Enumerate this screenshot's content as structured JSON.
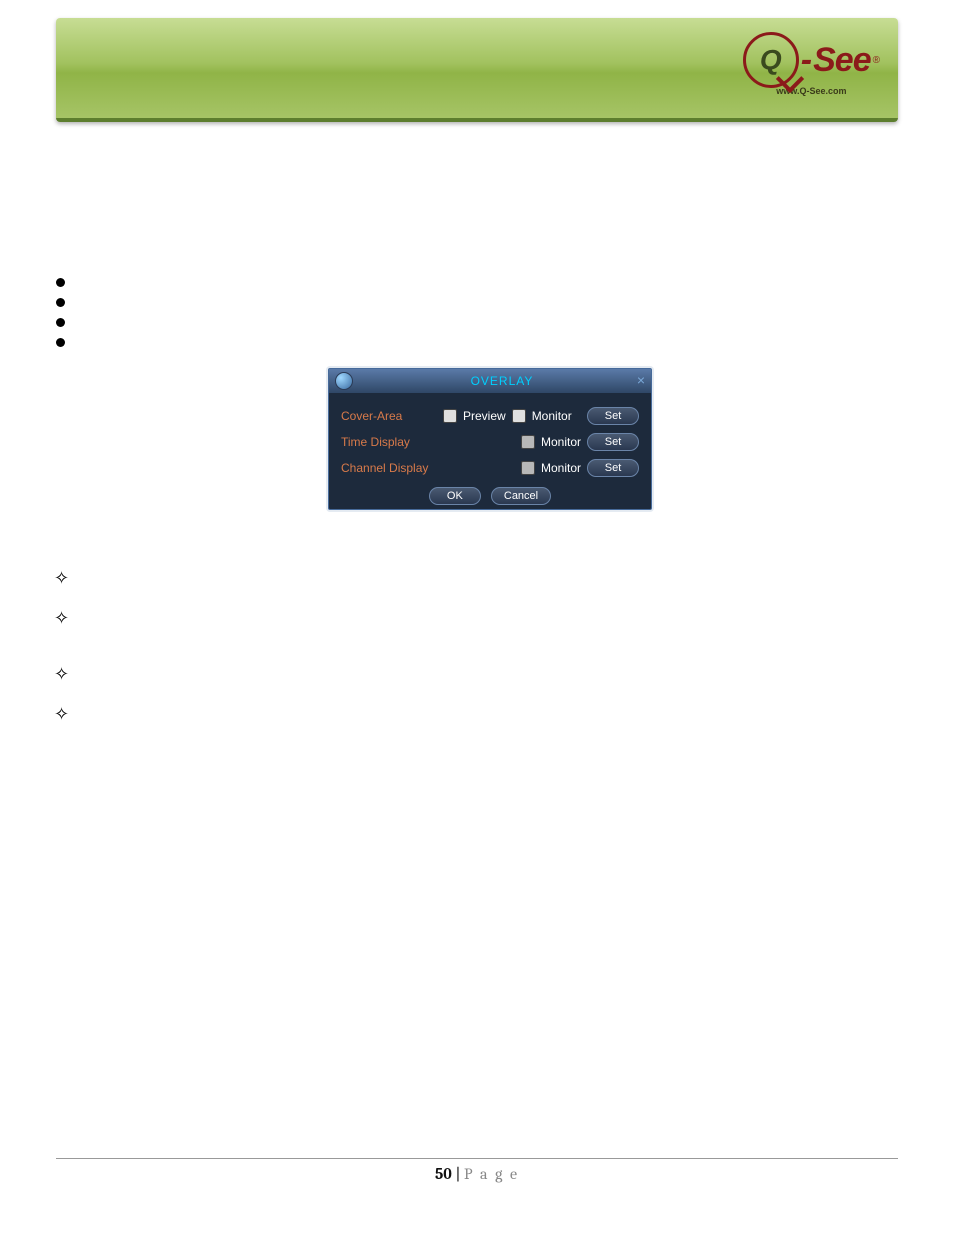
{
  "logo": {
    "brand_dash": "-",
    "brand_see": "See",
    "reg": "®",
    "url": "www.Q-See.com",
    "q_inner": "Q"
  },
  "overlay": {
    "title": "OVERLAY",
    "close_glyph": "×",
    "rows": {
      "cover_area": {
        "label": "Cover-Area",
        "preview": "Preview",
        "monitor": "Monitor",
        "set": "Set"
      },
      "time_display": {
        "label": "Time Display",
        "monitor": "Monitor",
        "set": "Set"
      },
      "channel_display": {
        "label": "Channel Display",
        "monitor": "Monitor",
        "set": "Set"
      }
    },
    "ok": "OK",
    "cancel": "Cancel"
  },
  "footer": {
    "num": "50",
    "sep": " | ",
    "word": "P a g e"
  }
}
